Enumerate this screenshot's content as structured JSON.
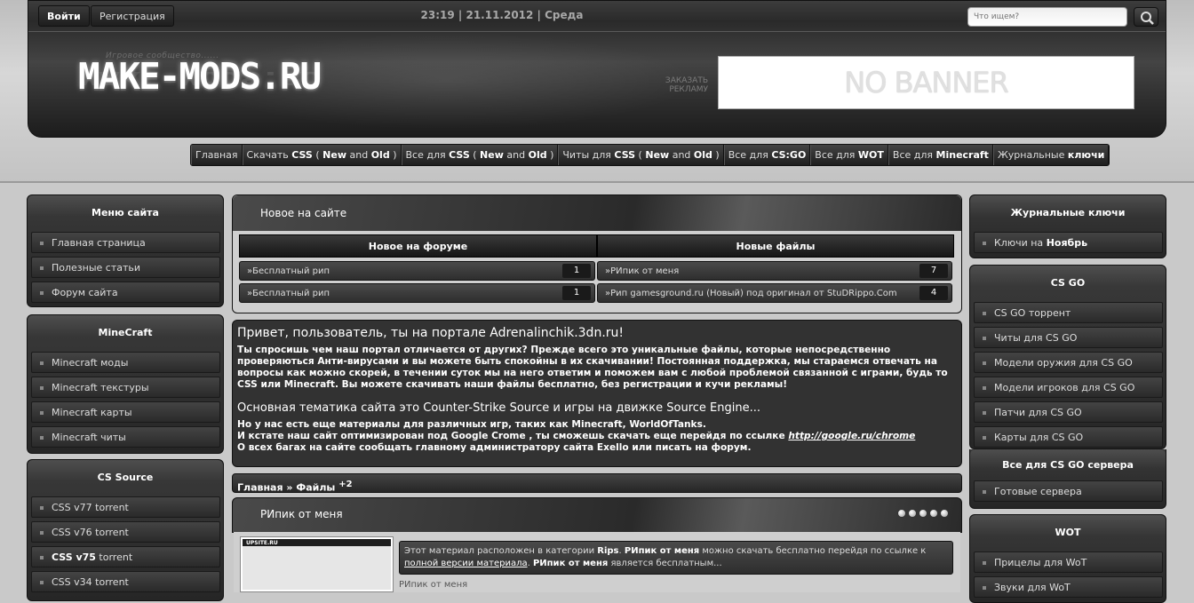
{
  "header": {
    "login": "Войти",
    "register": "Регистрация",
    "datetime": "23:19 | 21.11.2012 | Среда",
    "search_placeholder": "Что ищем?",
    "slogan": "Игровое сообщество......",
    "logo": "MAKE-MODS.RU",
    "order_ad": "ЗАКАЗАТЬ РЕКЛАМУ",
    "banner": "NO BANNER"
  },
  "nav": [
    {
      "pre": "Главная",
      "b1": "",
      "mid": "",
      "b2": "",
      "post": ""
    },
    {
      "pre": "Скачать ",
      "b1": "CSS",
      "mid": " ( ",
      "b2": "New",
      "post": " and ",
      "b3": "Old",
      "end": " )"
    },
    {
      "pre": "Все для ",
      "b1": "CSS",
      "mid": " ( ",
      "b2": "New",
      "post": " and ",
      "b3": "Old",
      "end": " )"
    },
    {
      "pre": "Читы для ",
      "b1": "CSS",
      "mid": " ( ",
      "b2": "New",
      "post": " and ",
      "b3": "Old",
      "end": " )"
    },
    {
      "pre": "Все для ",
      "b1": "CS:GO",
      "mid": "",
      "b2": "",
      "post": ""
    },
    {
      "pre": "Все для ",
      "b1": "WOT",
      "mid": "",
      "b2": "",
      "post": ""
    },
    {
      "pre": "Все для ",
      "b1": "Minecraft",
      "mid": "",
      "b2": "",
      "post": ""
    },
    {
      "pre": "Журнальные ",
      "b1": "ключи",
      "mid": "",
      "b2": "",
      "post": ""
    }
  ],
  "left": {
    "menu": {
      "title": "Меню сайта",
      "items": [
        "Главная страница",
        "Полезные статьи",
        "Форум сайта"
      ]
    },
    "minecraft": {
      "title": "MineCraft",
      "items": [
        "Minecraft моды",
        "Minecraft текстуры",
        "Minecraft карты",
        "Minecraft читы"
      ]
    },
    "css": {
      "title": "CS Source",
      "items": [
        "CSS v77 torrent",
        "CSS v76 torrent",
        "CSS v75",
        "CSS v34 torrent"
      ],
      "item3_suffix": " torrent"
    }
  },
  "right": {
    "keys": {
      "title": "Журнальные ключи",
      "item_pre": "Ключи на ",
      "item_b": "Ноябрь"
    },
    "csgo": {
      "title": "CS GO",
      "items": [
        "CS GO торрент",
        "Читы для CS GO",
        "Модели оружия для CS GO",
        "Модели игроков для CS GO",
        "Патчи для CS GO",
        "Карты для CS GO"
      ]
    },
    "csgo_server": {
      "title": "Все для CS GO сервера",
      "items": [
        "Готовые сервера"
      ]
    },
    "wot": {
      "title": "WOT",
      "items": [
        "Прицелы для WoT",
        "Звуки для WoT"
      ]
    }
  },
  "news": {
    "title": "Новое на сайте",
    "forum_header": "Новое на форуме",
    "files_header": "Новые файлы",
    "forum_rows": [
      {
        "text": "»Бесплатный рип",
        "count": "1"
      },
      {
        "text": "»Бесплатный рип",
        "count": "1"
      }
    ],
    "file_rows": [
      {
        "text": "»РИпик от меня",
        "count": "7"
      },
      {
        "text": "»Рип gamesground.ru (Новый) под оригинал от StuDRippo.Com",
        "count": "4"
      }
    ]
  },
  "welcome": {
    "heading": "Привет, пользователь, ты на портале Adrenalinchik.3dn.ru!",
    "para1": "Ты спросишь чем наш портал отличается от других? Прежде всего это уникальные файлы, которые непосредственно проверяються Анти-вирусами и вы можете быть спокойны в их скачивании! Постоянная поддержка, мы стараемся отвечать на вопросы как можно скорей, в течении суток мы на него ответим и поможем вам с любой проблемой связанной с играми, будь то CSS или Minecraft. Вы можете скачивать наши файлы бесплатно, без регистрации и кучи рекламы!",
    "heading2": "Основная тематика сайта это Counter-Strike Source и игры на движке Source Engine...",
    "line1": "Но у нас есть еще материалы для различных игр, таких как Minecraft, WorldOfTanks.",
    "line2_pre": "И кстате наш сайт оптимизирован под Google Crome , ты сможешь скачать еще перейдя по ссылке ",
    "line2_link": "http://google.ru/chrome",
    "line3": "О всех багах на сайте сообщать главному администратору сайта Exello или писать на форум."
  },
  "breadcrumb": {
    "home": "Главная",
    "sep": " » ",
    "files": "Файлы",
    "badge": "+2"
  },
  "entry": {
    "title": "РИпик от меня",
    "thumb_logo": "UPSITE.RU",
    "desc_1": "Этот материал расположен в категории ",
    "desc_cat": "Rips",
    "desc_2": ". ",
    "desc_name": "РИпик от меня",
    "desc_3": " можно скачать бесплатно перейдя по ссылке к ",
    "desc_link": "полной версии материала",
    "desc_4": ". ",
    "desc_name2": "РИпик от меня",
    "desc_5": " является бесплатным...",
    "footer": "РИпик от меня"
  }
}
